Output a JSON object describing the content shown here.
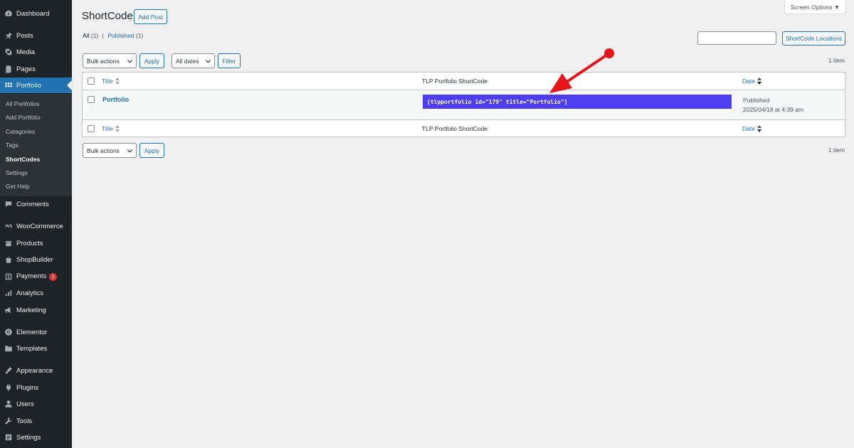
{
  "sidebar": {
    "items": [
      {
        "label": "Dashboard",
        "icon": "dashboard-icon"
      },
      {
        "label": "Posts",
        "icon": "pin-icon"
      },
      {
        "label": "Media",
        "icon": "media-icon"
      },
      {
        "label": "Pages",
        "icon": "pages-icon"
      },
      {
        "label": "Portfolio",
        "icon": "portfolio-icon",
        "active": true
      },
      {
        "label": "Comments",
        "icon": "comments-icon"
      },
      {
        "label": "WooCommerce",
        "icon": "woocommerce-icon"
      },
      {
        "label": "Products",
        "icon": "products-icon"
      },
      {
        "label": "ShopBuilder",
        "icon": "shopbuilder-icon"
      },
      {
        "label": "Payments",
        "icon": "payments-icon",
        "badge": "1"
      },
      {
        "label": "Analytics",
        "icon": "analytics-icon"
      },
      {
        "label": "Marketing",
        "icon": "marketing-icon"
      },
      {
        "label": "Elementor",
        "icon": "elementor-icon"
      },
      {
        "label": "Templates",
        "icon": "templates-icon"
      },
      {
        "label": "Appearance",
        "icon": "appearance-icon"
      },
      {
        "label": "Plugins",
        "icon": "plugins-icon"
      },
      {
        "label": "Users",
        "icon": "users-icon"
      },
      {
        "label": "Tools",
        "icon": "tools-icon"
      },
      {
        "label": "Settings",
        "icon": "settings-icon"
      }
    ],
    "submenu": [
      {
        "label": "All Portfolios"
      },
      {
        "label": "Add Portfolio"
      },
      {
        "label": "Categories"
      },
      {
        "label": "Tags"
      },
      {
        "label": "ShortCodes",
        "current": true
      },
      {
        "label": "Settings"
      },
      {
        "label": "Get Help"
      }
    ]
  },
  "header": {
    "title": "ShortCode",
    "add_button": "Add Post",
    "screen_options": "Screen Options ▼"
  },
  "views": {
    "all_label": "All",
    "all_count": "(1)",
    "separator": "|",
    "published_label": "Published",
    "published_count": "(1)"
  },
  "search": {
    "placeholder": "",
    "button": "ShortCode Locations"
  },
  "top_nav": {
    "bulk_select": "Bulk actions",
    "apply": "Apply",
    "dates_select": "All dates",
    "filter": "Filter",
    "count": "1 item"
  },
  "bottom_nav": {
    "bulk_select": "Bulk actions",
    "apply": "Apply",
    "count": "1 item"
  },
  "table": {
    "columns": {
      "title": "Title",
      "shortcode": "TLP Portfolio ShortCode",
      "date": "Date"
    },
    "rows": [
      {
        "title": "Portfolio",
        "shortcode": "[tlpportfolio id=\"179\" title=\"Portfolio\"]",
        "status": "Published",
        "date": "2025/04/18 at 4:39 am"
      }
    ]
  },
  "colors": {
    "sidebar_bg": "#1d2327",
    "accent": "#2271b1",
    "shortcode_bg": "#4f3ef0",
    "arrow": "#e8141b"
  }
}
